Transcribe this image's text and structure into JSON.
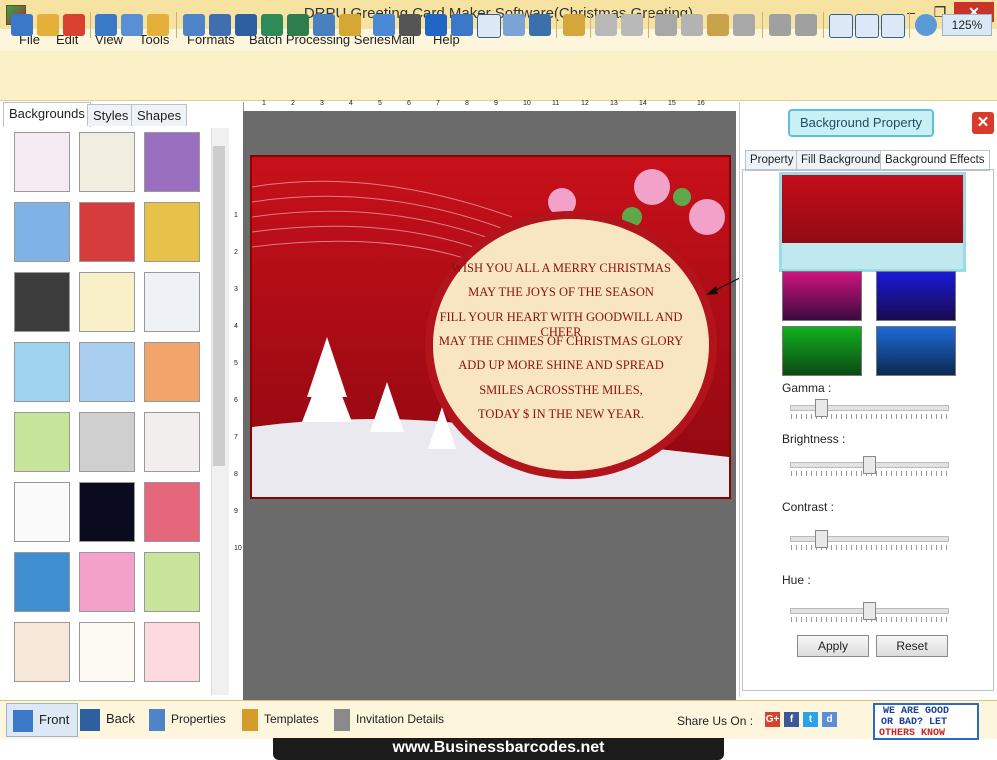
{
  "window": {
    "title": "DRPU Greeting Card Maker Software(Christmas Greeting)",
    "min": "–",
    "max": "❐",
    "close": "✕"
  },
  "menu": [
    "File",
    "Edit",
    "View",
    "Tools",
    "Formats",
    "Batch Processing Series",
    "Mail",
    "Help"
  ],
  "toolbar": {
    "icons": [
      "new-icon",
      "open-icon",
      "close-file-icon",
      "save-icon",
      "save-as-icon",
      "export-icon",
      "properties-icon",
      "print-icon",
      "print-preview-icon",
      "image-icon",
      "signature-icon",
      "picture-icon",
      "barcode-icon",
      "barcode2-icon",
      "text-icon",
      "word-art-icon",
      "symbol-icon",
      "email-icon",
      "line-icon",
      "database-icon",
      "undo-icon",
      "redo-icon",
      "cut-icon",
      "copy-icon",
      "paste-icon",
      "delete-icon",
      "bring-front-icon",
      "send-back-icon",
      "grid-icon",
      "actual-size-icon",
      "fit-window-icon",
      "zoom-icon"
    ],
    "zoom": "125%"
  },
  "left_panel": {
    "tabs": [
      "Backgrounds",
      "Styles",
      "Shapes"
    ],
    "active_tab": "Backgrounds"
  },
  "ruler": {
    "h_ticks": [
      "1",
      "2",
      "3",
      "4",
      "5",
      "6",
      "7",
      "8",
      "9",
      "10",
      "11",
      "12",
      "13",
      "14",
      "15",
      "16"
    ],
    "v_ticks": [
      "1",
      "2",
      "3",
      "4",
      "5",
      "6",
      "7",
      "8",
      "9",
      "10"
    ]
  },
  "card": {
    "lines": [
      "WISH YOU ALL A MERRY CHRISTMAS",
      "MAY THE JOYS OF THE SEASON",
      "FILL YOUR HEART WITH GOODWILL AND CHEER",
      "MAY THE CHIMES OF CHRISTMAS GLORY",
      "ADD UP MORE SHINE AND SPREAD",
      "SMILES ACROSSTHE MILES,",
      "TODAY $ IN THE NEW YEAR."
    ]
  },
  "right_panel": {
    "title": "Background Property",
    "close": "✕",
    "tabs": [
      "Property",
      "Fill Background",
      "Background Effects"
    ],
    "active_tab": "Background Effects",
    "sliders": [
      {
        "label": "Gamma :",
        "level": 0.2
      },
      {
        "label": "Brightness :",
        "level": 0.5
      },
      {
        "label": "Contrast :",
        "level": 0.2
      },
      {
        "label": "Hue :",
        "level": 0.5
      }
    ],
    "apply": "Apply",
    "reset": "Reset"
  },
  "bottom_bar": {
    "front": "Front",
    "back": "Back",
    "properties": "Properties",
    "templates": "Templates",
    "invitation": "Invitation Details",
    "share_label": "Share Us On :",
    "social": [
      "G+",
      "f",
      "t",
      "d"
    ],
    "banner": [
      "WE ARE GOOD",
      "OR BAD? LET",
      "OTHERS KNOW"
    ]
  },
  "footer": "www.Businessbarcodes.net",
  "colors": {
    "titlebar": "#f6e3a2",
    "card_red": "#b3141c",
    "accent": "#2a69c4"
  }
}
